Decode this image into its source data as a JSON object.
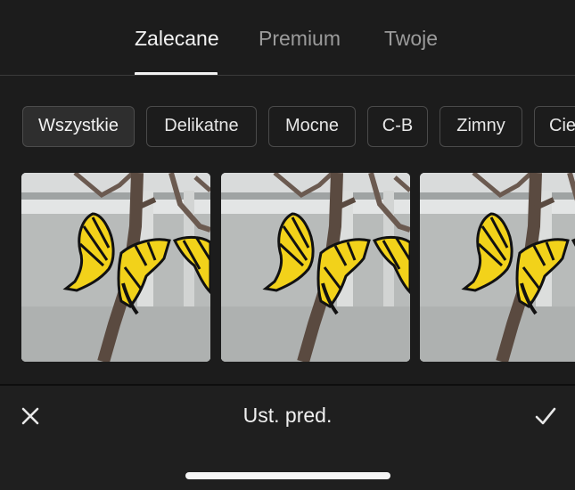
{
  "tabs": [
    {
      "label": "Zalecane",
      "active": true
    },
    {
      "label": "Premium",
      "active": false
    },
    {
      "label": "Twoje",
      "active": false
    }
  ],
  "filters": [
    {
      "label": "Wszystkie",
      "selected": true
    },
    {
      "label": "Delikatne",
      "selected": false
    },
    {
      "label": "Mocne",
      "selected": false
    },
    {
      "label": "C-B",
      "selected": false
    },
    {
      "label": "Zimny",
      "selected": false
    },
    {
      "label": "Cie",
      "selected": false
    }
  ],
  "presets": [
    {
      "icon": "butterfly-photo-thumbnail"
    },
    {
      "icon": "butterfly-photo-thumbnail"
    },
    {
      "icon": "butterfly-photo-thumbnail"
    }
  ],
  "bottom_bar": {
    "title": "Ust. pred.",
    "close_icon": "close-icon",
    "confirm_icon": "checkmark-icon"
  },
  "colors": {
    "background": "#1c1c1c",
    "text_active": "#f2f2f2",
    "text_inactive": "#9b9b9b",
    "butterfly_yellow": "#f2d21a"
  }
}
